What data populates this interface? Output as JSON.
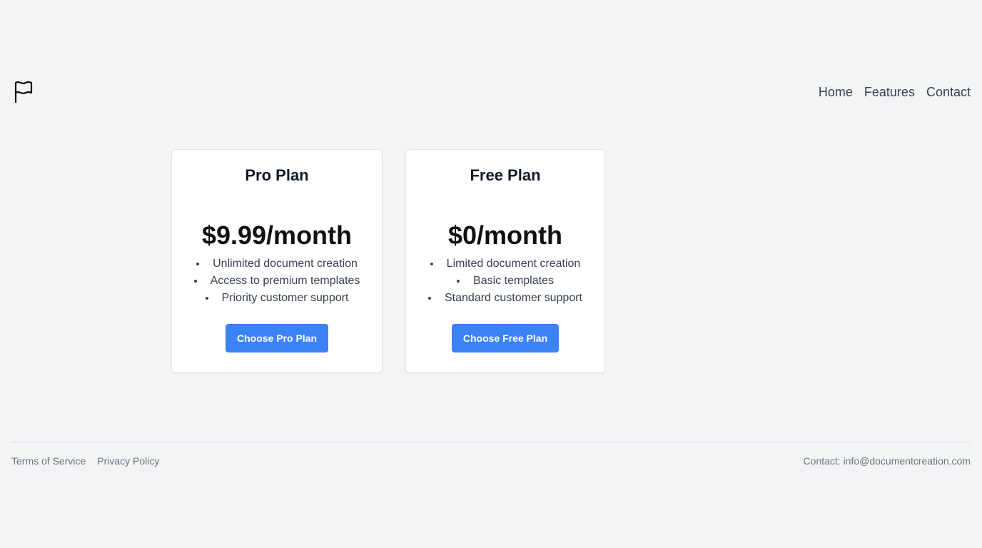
{
  "header": {
    "logo_icon": "flag-icon",
    "nav": [
      {
        "label": "Home"
      },
      {
        "label": "Features"
      },
      {
        "label": "Contact"
      }
    ]
  },
  "plans": [
    {
      "title": "Pro Plan",
      "price": "$9.99/month",
      "features": [
        "Unlimited document creation",
        "Access to premium templates",
        "Priority customer support"
      ],
      "button_label": "Choose Pro Plan"
    },
    {
      "title": "Free Plan",
      "price": "$0/month",
      "features": [
        "Limited document creation",
        "Basic templates",
        "Standard customer support"
      ],
      "button_label": "Choose Free Plan"
    }
  ],
  "footer": {
    "links": [
      {
        "label": "Terms of Service"
      },
      {
        "label": "Privacy Policy"
      }
    ],
    "contact": "Contact: info@documentcreation.com"
  },
  "colors": {
    "background": "#f3f4f6",
    "accent": "#3b82f6",
    "card": "#ffffff",
    "text": "#374151"
  }
}
